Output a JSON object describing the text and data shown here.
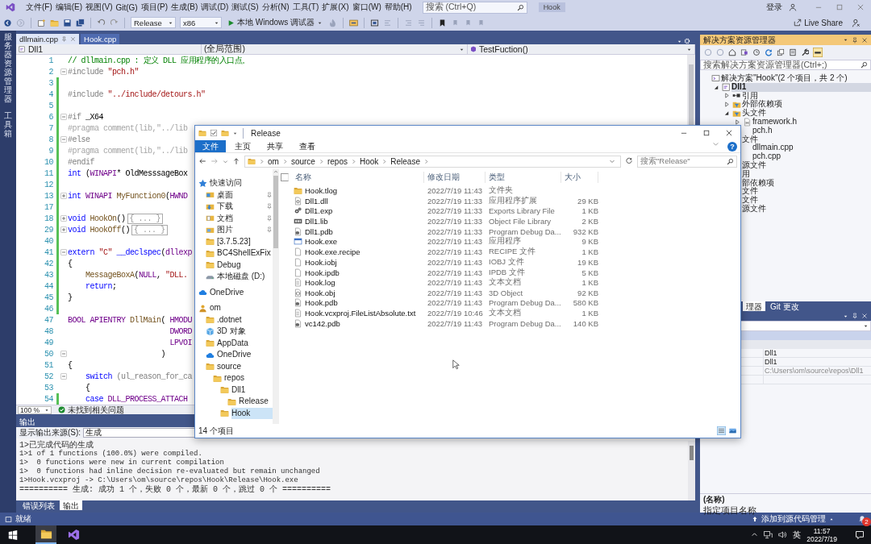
{
  "menu_bar": {
    "items": [
      "文件(F)",
      "编辑(E)",
      "视图(V)",
      "Git(G)",
      "项目(P)",
      "生成(B)",
      "调试(D)",
      "测试(S)",
      "分析(N)",
      "工具(T)",
      "扩展(X)",
      "窗口(W)",
      "帮助(H)"
    ],
    "search_placeholder": "搜索 (Ctrl+Q)",
    "solution_name": "Hook",
    "sign_in": "登录"
  },
  "toolbar": {
    "configuration": "Release",
    "platform": "x86",
    "debugger": "本地 Windows 调试器",
    "live_share": "Live Share"
  },
  "left_strip": [
    "服务器资源管理器",
    "工具箱"
  ],
  "document_tabs": [
    {
      "label": "dllmain.cpp",
      "selected": true
    },
    {
      "label": "Hook.cpp",
      "selected": false
    }
  ],
  "editor": {
    "project": "Dll1",
    "scope": "(全局范围)",
    "member": "TestFuction()",
    "zoom": "100 %",
    "issues": "未找到相关问题",
    "lines": [
      {
        "number": "1",
        "changed": false,
        "tokens": [
          {
            "kind": "comment",
            "text": "// dllmain.cpp : 定义 DLL 应用程序的入口点。"
          }
        ]
      },
      {
        "number": "2",
        "changed": false,
        "expanded": true,
        "tokens": [
          {
            "kind": "preproc",
            "text": "#include "
          },
          {
            "kind": "string",
            "text": "\"pch.h\""
          }
        ]
      },
      {
        "number": "3",
        "changed": true
      },
      {
        "number": "4",
        "changed": true,
        "tokens": [
          {
            "kind": "preproc",
            "text": "#include "
          },
          {
            "kind": "string",
            "text": "\"../include/detours.h\""
          }
        ]
      },
      {
        "number": "5",
        "changed": true
      },
      {
        "number": "6",
        "changed": true,
        "expanded": true,
        "tokens": [
          {
            "kind": "preproc",
            "text": "#if "
          },
          {
            "kind": "plain",
            "text": "_X64"
          }
        ]
      },
      {
        "number": "7",
        "changed": true,
        "tokens": [
          {
            "kind": "inactive",
            "text": "#pragma comment(lib,\"../lib"
          }
        ]
      },
      {
        "number": "8",
        "changed": true,
        "expanded": true,
        "tokens": [
          {
            "kind": "preproc",
            "text": "#else"
          }
        ]
      },
      {
        "number": "9",
        "changed": true,
        "tokens": [
          {
            "kind": "inactive",
            "text": "#pragma comment(lib,\"../lib"
          }
        ]
      },
      {
        "number": "10",
        "changed": true,
        "tokens": [
          {
            "kind": "preproc",
            "text": "#endif"
          }
        ]
      },
      {
        "number": "11",
        "changed": true,
        "tokens": [
          {
            "kind": "keyword",
            "text": "int "
          },
          {
            "kind": "plain",
            "text": "("
          },
          {
            "kind": "macro",
            "text": "WINAPI"
          },
          {
            "kind": "plain",
            "text": "* OldMesssageBox"
          }
        ]
      },
      {
        "number": "12",
        "changed": true
      },
      {
        "number": "13",
        "changed": true,
        "expanded": false,
        "tokens": [
          {
            "kind": "keyword",
            "text": "int "
          },
          {
            "kind": "macro",
            "text": "WINAPI "
          },
          {
            "kind": "func",
            "text": "MyFunction0"
          },
          {
            "kind": "plain",
            "text": "("
          },
          {
            "kind": "macro",
            "text": "HWND"
          }
        ]
      },
      {
        "number": "17",
        "changed": true
      },
      {
        "number": "18",
        "changed": true,
        "expanded": false,
        "tokens": [
          {
            "kind": "keyword",
            "text": "void "
          },
          {
            "kind": "func",
            "text": "HookOn"
          },
          {
            "kind": "plain",
            "text": "()"
          },
          {
            "kind": "folded",
            "text": "{ ... }"
          }
        ]
      },
      {
        "number": "29",
        "changed": true,
        "expanded": false,
        "tokens": [
          {
            "kind": "keyword",
            "text": "void "
          },
          {
            "kind": "func",
            "text": "HookOff"
          },
          {
            "kind": "plain",
            "text": "()"
          },
          {
            "kind": "folded",
            "text": "{ ... }"
          }
        ]
      },
      {
        "number": "40",
        "changed": true
      },
      {
        "number": "41",
        "changed": true,
        "expanded": true,
        "tokens": [
          {
            "kind": "keyword",
            "text": "extern "
          },
          {
            "kind": "string",
            "text": "\"C\" "
          },
          {
            "kind": "keyword",
            "text": "__declspec"
          },
          {
            "kind": "plain",
            "text": "("
          },
          {
            "kind": "macro",
            "text": "dllexp"
          }
        ]
      },
      {
        "number": "42",
        "changed": true,
        "tokens": [
          {
            "kind": "plain",
            "text": "{"
          }
        ]
      },
      {
        "number": "43",
        "changed": true,
        "tokens": [
          {
            "kind": "func",
            "text": "    MessageBoxA"
          },
          {
            "kind": "plain",
            "text": "("
          },
          {
            "kind": "macro",
            "text": "NULL"
          },
          {
            "kind": "plain",
            "text": ", "
          },
          {
            "kind": "string",
            "text": "\"DLL."
          }
        ]
      },
      {
        "number": "44",
        "changed": true,
        "tokens": [
          {
            "kind": "keyword",
            "text": "    return"
          },
          {
            "kind": "plain",
            "text": ";"
          }
        ]
      },
      {
        "number": "45",
        "changed": true,
        "tokens": [
          {
            "kind": "plain",
            "text": "}"
          }
        ]
      },
      {
        "number": "46",
        "changed": true
      },
      {
        "number": "47",
        "changed": false,
        "tokens": [
          {
            "kind": "macro",
            "text": "BOOL APIENTRY "
          },
          {
            "kind": "func",
            "text": "DllMain"
          },
          {
            "kind": "plain",
            "text": "( "
          },
          {
            "kind": "macro",
            "text": "HMODU"
          }
        ]
      },
      {
        "number": "48",
        "changed": false,
        "tokens": [
          {
            "kind": "macro",
            "text": "                       DWORD"
          }
        ]
      },
      {
        "number": "49",
        "changed": false,
        "tokens": [
          {
            "kind": "macro",
            "text": "                       LPVOI"
          }
        ]
      },
      {
        "number": "50",
        "changed": false,
        "expanded": true,
        "tokens": [
          {
            "kind": "plain",
            "text": "                     )"
          }
        ]
      },
      {
        "number": "51",
        "changed": false,
        "tokens": [
          {
            "kind": "plain",
            "text": "{"
          }
        ]
      },
      {
        "number": "52",
        "changed": false,
        "expanded": true,
        "tokens": [
          {
            "kind": "keyword",
            "text": "    switch "
          },
          {
            "kind": "param",
            "text": "(ul_reason_for_ca"
          }
        ]
      },
      {
        "number": "53",
        "changed": false,
        "tokens": [
          {
            "kind": "plain",
            "text": "    {"
          }
        ]
      },
      {
        "number": "54",
        "changed": true,
        "tokens": [
          {
            "kind": "keyword",
            "text": "    case "
          },
          {
            "kind": "macro",
            "text": "DLL_PROCESS_ATTACH"
          }
        ]
      }
    ]
  },
  "output": {
    "title": "输出",
    "source_label": "显示输出来源(S):",
    "source": "生成",
    "lines": [
      "1>已完成代码的生成",
      "1>1 of 1 functions (100.0%) were compiled.",
      "1>  0 functions were new in current compilation",
      "1>  0 functions had inline decision re-evaluated but remain unchanged",
      "1>Hook.vcxproj -> C:\\Users\\om\\source\\repos\\Hook\\Release\\Hook.exe",
      "========== 生成: 成功 1 个，失败 0 个，最新 0 个，跳过 0 个 =========="
    ],
    "tabs": [
      {
        "label": "错误列表",
        "selected": false
      },
      {
        "label": "输出",
        "selected": true
      }
    ]
  },
  "status_bar": {
    "text": "就绪",
    "source_control": "添加到源代码管理",
    "notifications": "2"
  },
  "solution_explorer": {
    "title": "解决方案资源管理器",
    "search_placeholder": "搜索解决方案资源管理器(Ctrl+;)",
    "tree": [
      {
        "label": "解决方案\"Hook\"(2 个项目，共 2 个)",
        "kind": "solution",
        "selected": false,
        "children": [
          {
            "label": "Dll1",
            "kind": "project",
            "expanded": true,
            "selected": true,
            "children": [
              {
                "label": "引用",
                "kind": "refs",
                "expanded": false,
                "selected": false
              },
              {
                "label": "外部依赖项",
                "kind": "filter",
                "expanded": false,
                "selected": false
              },
              {
                "label": "头文件",
                "kind": "filter",
                "expanded": true,
                "selected": false,
                "children": [
                  {
                    "label": "framework.h",
                    "kind": "header",
                    "expanded": false,
                    "selected": false
                  },
                  {
                    "label": "pch.h",
                    "selected": false
                  }
                ]
              },
              {
                "label": "文件",
                "selected": false,
                "children": [
                  {
                    "label": "dllmain.cpp",
                    "selected": false
                  },
                  {
                    "label": "pch.cpp",
                    "selected": false
                  }
                ]
              },
              {
                "label": "源文件",
                "selected": false
              }
            ]
          },
          {
            "children": [
              {
                "label": "用",
                "selected": false
              },
              {
                "label": "部依赖项",
                "selected": false
              },
              {
                "label": "文件",
                "selected": false
              },
              {
                "label": "文件",
                "selected": false
              },
              {
                "label": "源文件",
                "selected": false
              }
            ]
          }
        ]
      }
    ]
  },
  "right_tabs": [
    {
      "label": "理器",
      "selected": true
    },
    {
      "label": "Git 更改",
      "selected": false
    }
  ],
  "properties": {
    "values": [
      "Dll1",
      "Dll1",
      "C:\\Users\\om\\source\\repos\\Dll1"
    ],
    "name_title": "(名称)",
    "description": "指定项目名称"
  },
  "file_explorer": {
    "title": "Release",
    "ribbon_tabs": [
      {
        "label": "文件",
        "selected": true
      },
      {
        "label": "主页",
        "selected": false
      },
      {
        "label": "共享",
        "selected": false
      },
      {
        "label": "查看",
        "selected": false
      }
    ],
    "help": "?",
    "path": [
      "om",
      "source",
      "repos",
      "Hook",
      "Release"
    ],
    "search_placeholder": "搜索\"Release\"",
    "nav": [
      {
        "label": "快速访问",
        "kind": "star",
        "selected": false,
        "children": [
          {
            "label": "桌面",
            "kind": "desktop",
            "pinned": true,
            "selected": false
          },
          {
            "label": "下载",
            "kind": "download",
            "pinned": true,
            "selected": false
          },
          {
            "label": "文档",
            "kind": "document",
            "pinned": true,
            "selected": false
          },
          {
            "label": "图片",
            "kind": "picture",
            "pinned": true,
            "selected": false
          },
          {
            "label": "[3.7.5.23]",
            "kind": "folder",
            "pinned": false,
            "selected": false
          },
          {
            "label": "BC4ShellExFix",
            "kind": "folder",
            "pinned": false,
            "selected": false
          },
          {
            "label": "Debug",
            "kind": "folder",
            "pinned": false,
            "selected": false
          },
          {
            "label": "本地磁盘 (D:)",
            "kind": "drive",
            "pinned": false,
            "selected": false
          }
        ]
      },
      {
        "label": "OneDrive",
        "kind": "cloud",
        "selected": false
      },
      {
        "label": "om",
        "kind": "user",
        "selected": false,
        "children": [
          {
            "label": ".dotnet",
            "kind": "folder",
            "selected": false
          },
          {
            "label": "3D 对象",
            "kind": "cube",
            "selected": false
          },
          {
            "label": "AppData",
            "kind": "folder",
            "selected": false
          },
          {
            "label": "OneDrive",
            "kind": "cloud",
            "selected": false
          },
          {
            "label": "source",
            "kind": "folder",
            "selected": false,
            "children": [
              {
                "label": "repos",
                "kind": "folder",
                "selected": false,
                "children": [
                  {
                    "label": "Dll1",
                    "kind": "folder",
                    "selected": false,
                    "children": [
                      {
                        "label": "Release",
                        "kind": "folder",
                        "selected": false
                      }
                    ]
                  },
                  {
                    "label": "Hook",
                    "kind": "folder",
                    "selected": true
                  }
                ]
              }
            ]
          }
        ]
      }
    ],
    "all_checked": false,
    "columns": [
      "名称",
      "修改日期",
      "类型",
      "大小"
    ],
    "files": [
      {
        "kind": "folder",
        "name": "Hook.tlog",
        "date": "2022/7/19 11:43",
        "type": "文件夹"
      },
      {
        "kind": "dll",
        "name": "Dll1.dll",
        "date": "2022/7/19 11:33",
        "type": "应用程序扩展",
        "size": "29 KB"
      },
      {
        "kind": "exp",
        "name": "Dll1.exp",
        "date": "2022/7/19 11:33",
        "type": "Exports Library File",
        "size": "1 KB"
      },
      {
        "kind": "lib",
        "name": "Dll1.lib",
        "date": "2022/7/19 11:33",
        "type": "Object File Library",
        "size": "2 KB"
      },
      {
        "kind": "pdb",
        "name": "Dll1.pdb",
        "date": "2022/7/19 11:33",
        "type": "Program Debug Da...",
        "size": "932 KB"
      },
      {
        "kind": "exe",
        "name": "Hook.exe",
        "date": "2022/7/19 11:43",
        "type": "应用程序",
        "size": "9 KB"
      },
      {
        "kind": "blank",
        "name": "Hook.exe.recipe",
        "date": "2022/7/19 11:43",
        "type": "RECIPE 文件",
        "size": "1 KB"
      },
      {
        "kind": "blank",
        "name": "Hook.iobj",
        "date": "2022/7/19 11:43",
        "type": "IOBJ 文件",
        "size": "19 KB"
      },
      {
        "kind": "blank",
        "name": "Hook.ipdb",
        "date": "2022/7/19 11:43",
        "type": "IPDB 文件",
        "size": "5 KB"
      },
      {
        "kind": "text",
        "name": "Hook.log",
        "date": "2022/7/19 11:43",
        "type": "文本文档",
        "size": "1 KB"
      },
      {
        "kind": "obj",
        "name": "Hook.obj",
        "date": "2022/7/19 11:43",
        "type": "3D Object",
        "size": "92 KB"
      },
      {
        "kind": "pdb",
        "name": "Hook.pdb",
        "date": "2022/7/19 11:43",
        "type": "Program Debug Da...",
        "size": "580 KB"
      },
      {
        "kind": "text",
        "name": "Hook.vcxproj.FileListAbsolute.txt",
        "date": "2022/7/19 10:46",
        "type": "文本文档",
        "size": "1 KB"
      },
      {
        "kind": "pdb",
        "name": "vc142.pdb",
        "date": "2022/7/19 11:43",
        "type": "Program Debug Da...",
        "size": "140 KB"
      }
    ],
    "item_count": "14 个项目"
  },
  "taskbar": {
    "apps": [
      {
        "kind": "explorer",
        "selected": true
      },
      {
        "kind": "vs",
        "selected": false
      }
    ],
    "input_method": "英",
    "time": "11:57",
    "date": "2022/7/19"
  }
}
